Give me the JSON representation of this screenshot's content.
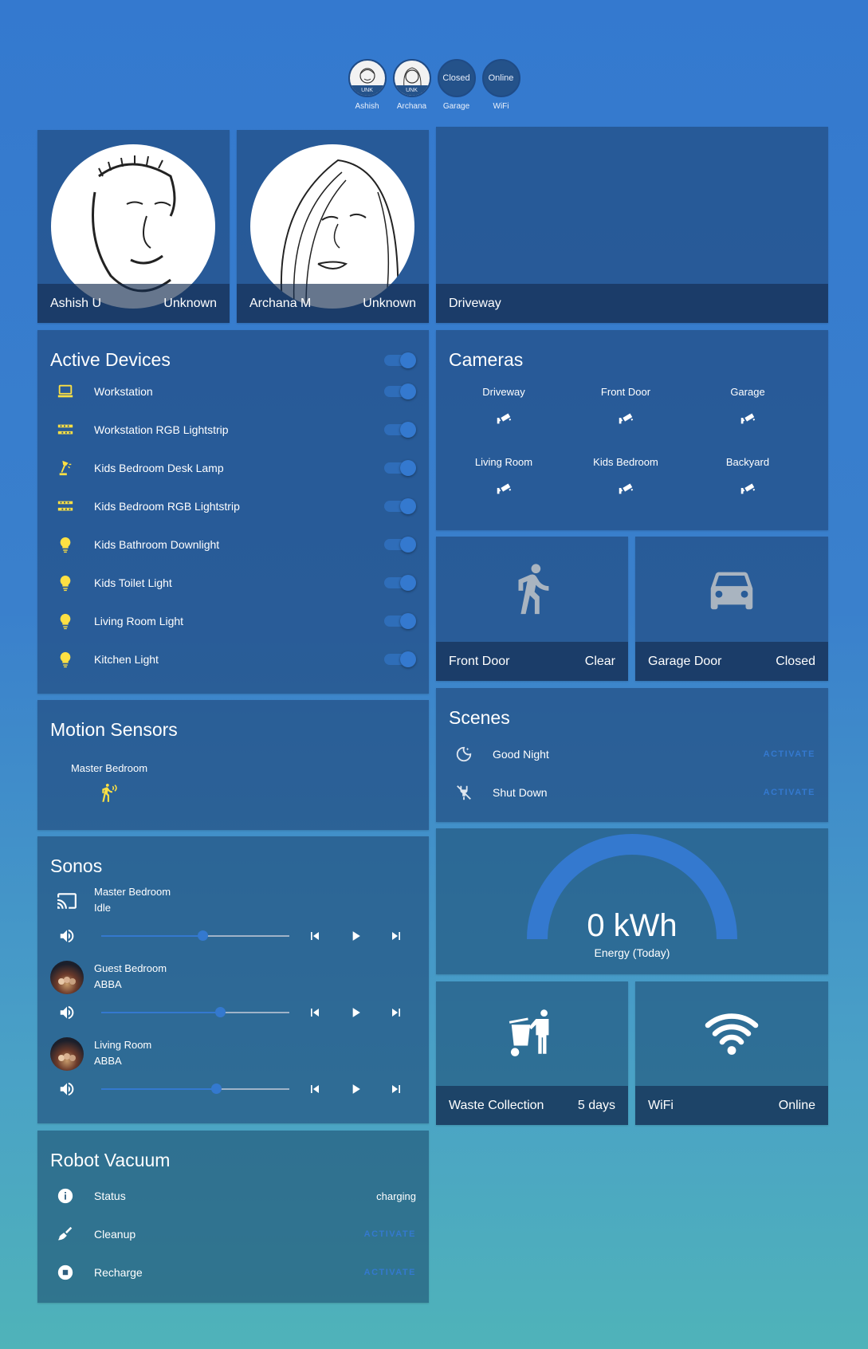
{
  "badges": [
    {
      "state": "UNK",
      "label": "Ashish"
    },
    {
      "state": "UNK",
      "label": "Archana"
    },
    {
      "state": "Closed",
      "label": "Garage"
    },
    {
      "state": "Online",
      "label": "WiFi"
    }
  ],
  "persons": [
    {
      "name": "Ashish U",
      "state": "Unknown"
    },
    {
      "name": "Archana M",
      "state": "Unknown"
    }
  ],
  "driveway": {
    "label": "Driveway"
  },
  "active_devices": {
    "title": "Active Devices",
    "items": [
      {
        "name": "Workstation",
        "icon": "desktop-icon",
        "on": true
      },
      {
        "name": "Workstation RGB Lightstrip",
        "icon": "led-strip-icon",
        "on": true
      },
      {
        "name": "Kids Bedroom Desk Lamp",
        "icon": "desk-lamp-icon",
        "on": true
      },
      {
        "name": "Kids Bedroom RGB Lightstrip",
        "icon": "led-strip-icon",
        "on": true
      },
      {
        "name": "Kids Bathroom Downlight",
        "icon": "lightbulb-icon",
        "on": true
      },
      {
        "name": "Kids Toilet Light",
        "icon": "lightbulb-icon",
        "on": true
      },
      {
        "name": "Living Room Light",
        "icon": "lightbulb-icon",
        "on": true
      },
      {
        "name": "Kitchen Light",
        "icon": "lightbulb-icon",
        "on": true
      }
    ]
  },
  "cameras": {
    "title": "Cameras",
    "items": [
      "Driveway",
      "Front Door",
      "Garage",
      "Living Room",
      "Kids Bedroom",
      "Backyard"
    ]
  },
  "front_door": {
    "label": "Front Door",
    "state": "Clear"
  },
  "garage_door": {
    "label": "Garage Door",
    "state": "Closed"
  },
  "motion_sensors": {
    "title": "Motion Sensors",
    "items": [
      "Master Bedroom"
    ]
  },
  "scenes": {
    "title": "Scenes",
    "items": [
      {
        "name": "Good Night",
        "action": "ACTIVATE",
        "icon": "moon-icon"
      },
      {
        "name": "Shut Down",
        "action": "ACTIVATE",
        "icon": "power-off-icon"
      }
    ]
  },
  "energy": {
    "value": "0 kWh",
    "label": "Energy (Today)"
  },
  "sonos": {
    "title": "Sonos",
    "players": [
      {
        "room": "Master Bedroom",
        "status": "Idle",
        "volume": 0.54
      },
      {
        "room": "Guest Bedroom",
        "status": "ABBA",
        "volume": 0.63
      },
      {
        "room": "Living Room",
        "status": "ABBA",
        "volume": 0.61
      }
    ]
  },
  "waste": {
    "label": "Waste Collection",
    "state": "5 days"
  },
  "wifi": {
    "label": "WiFi",
    "state": "Online"
  },
  "vacuum": {
    "title": "Robot Vacuum",
    "status_label": "Status",
    "status_value": "charging",
    "cleanup_label": "Cleanup",
    "cleanup_action": "ACTIVATE",
    "recharge_label": "Recharge",
    "recharge_action": "ACTIVATE"
  },
  "colors": {
    "accent": "#3479cf",
    "icon_yellow": "#fde043"
  }
}
